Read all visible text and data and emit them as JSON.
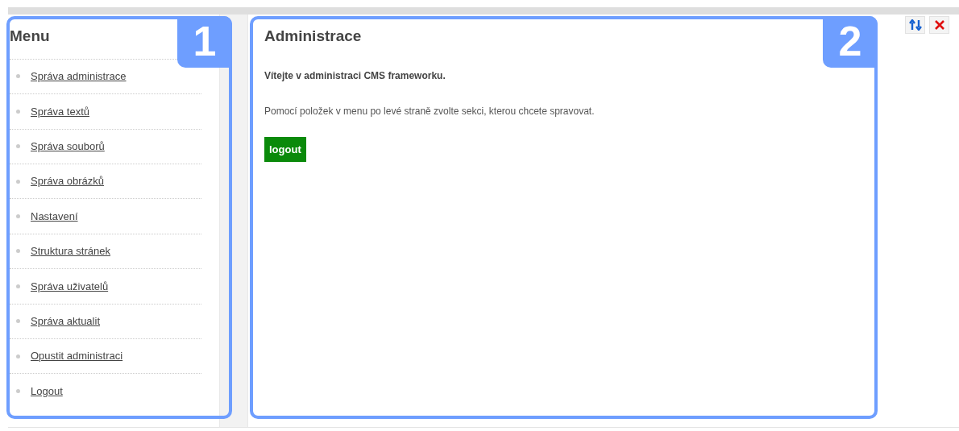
{
  "sidebar": {
    "title": "Menu",
    "items": [
      {
        "label": "Správa administrace"
      },
      {
        "label": "Správa textů"
      },
      {
        "label": "Správa souborů"
      },
      {
        "label": "Správa obrázků"
      },
      {
        "label": "Nastavení"
      },
      {
        "label": "Struktura stránek"
      },
      {
        "label": "Správa uživatelů"
      },
      {
        "label": "Správa aktualit"
      },
      {
        "label": "Opustit administraci"
      },
      {
        "label": "Logout"
      }
    ]
  },
  "main": {
    "title": "Administrace",
    "welcome": "Vítejte v administraci CMS frameworku.",
    "text": "Pomocí položek v menu po levé straně zvolte sekci, kterou chcete spravovat.",
    "button": "logout"
  },
  "toolbar": [
    {
      "kind": "swap"
    },
    {
      "kind": "close"
    }
  ],
  "annotations": [
    {
      "label": "1"
    },
    {
      "label": "2"
    }
  ]
}
